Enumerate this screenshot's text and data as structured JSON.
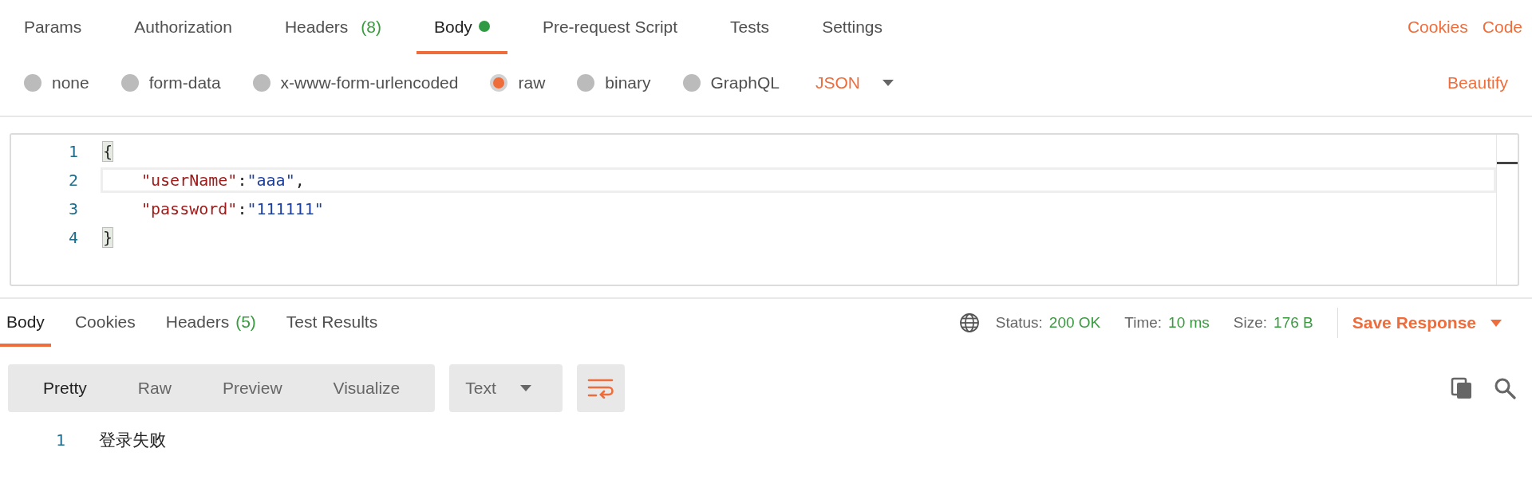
{
  "request_tabs": [
    {
      "label": "Params",
      "selected": false
    },
    {
      "label": "Authorization",
      "selected": false
    },
    {
      "label": "Headers",
      "count": "(8)",
      "selected": false
    },
    {
      "label": "Body",
      "dot": true,
      "selected": true
    },
    {
      "label": "Pre-request Script",
      "selected": false
    },
    {
      "label": "Tests",
      "selected": false
    },
    {
      "label": "Settings",
      "selected": false
    }
  ],
  "request_links": [
    "Cookies",
    "Code"
  ],
  "body_types": [
    {
      "label": "none",
      "selected": false
    },
    {
      "label": "form-data",
      "selected": false
    },
    {
      "label": "x-www-form-urlencoded",
      "selected": false
    },
    {
      "label": "raw",
      "selected": true
    },
    {
      "label": "binary",
      "selected": false
    },
    {
      "label": "GraphQL",
      "selected": false
    }
  ],
  "raw_format": "JSON",
  "beautify": "Beautify",
  "editor_lines": [
    {
      "number": "1",
      "current": false,
      "tokens": [
        {
          "kind": "bracket",
          "text": "{",
          "matched": true
        }
      ]
    },
    {
      "number": "2",
      "current": true,
      "tokens": [
        {
          "kind": "key",
          "text": "\"userName\"",
          "indented": true
        },
        {
          "kind": "punct",
          "text": ":"
        },
        {
          "kind": "string",
          "text": "\"aaa\""
        },
        {
          "kind": "punct",
          "text": ","
        }
      ]
    },
    {
      "number": "3",
      "current": false,
      "tokens": [
        {
          "kind": "key",
          "text": "\"password\"",
          "indented": true
        },
        {
          "kind": "punct",
          "text": ":"
        },
        {
          "kind": "string",
          "text": "\"111111\""
        }
      ]
    },
    {
      "number": "4",
      "current": false,
      "tokens": [
        {
          "kind": "bracket",
          "text": "}",
          "matched": true
        }
      ]
    }
  ],
  "response_tabs": [
    {
      "label": "Body",
      "selected": true
    },
    {
      "label": "Cookies",
      "selected": false
    },
    {
      "label": "Headers",
      "count": "(5)",
      "selected": false
    },
    {
      "label": "Test Results",
      "selected": false
    }
  ],
  "response_stats": [
    {
      "label": "Status:",
      "value": "200 OK"
    },
    {
      "label": "Time:",
      "value": "10 ms"
    },
    {
      "label": "Size:",
      "value": "176 B"
    }
  ],
  "save_response": "Save Response",
  "view_modes": [
    {
      "label": "Pretty",
      "selected": true
    },
    {
      "label": "Raw",
      "selected": false
    },
    {
      "label": "Preview",
      "selected": false
    },
    {
      "label": "Visualize",
      "selected": false
    }
  ],
  "response_format": "Text",
  "wrap_lines": {
    "on": true
  },
  "response_lines": [
    {
      "number": "1",
      "text": "登录失败"
    }
  ]
}
